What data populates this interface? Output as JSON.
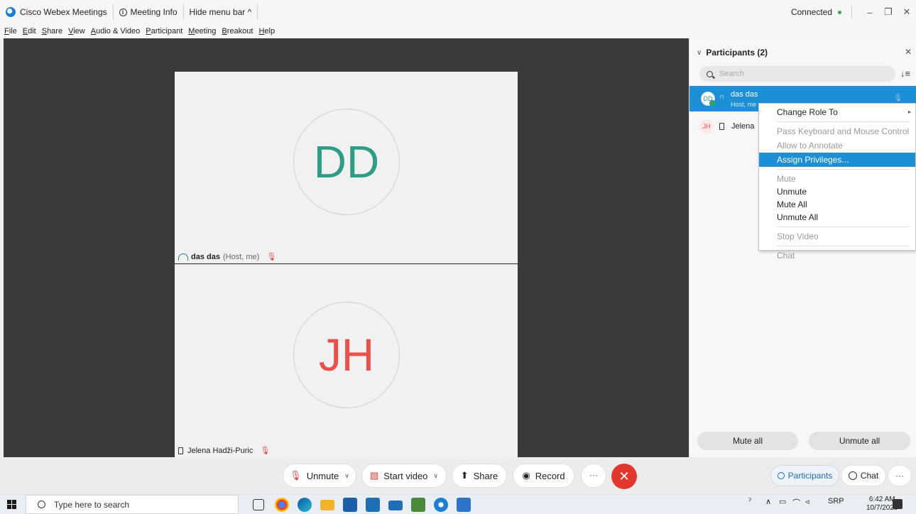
{
  "titlebar": {
    "app_name": "Cisco Webex Meetings",
    "meeting_info": "Meeting Info",
    "hide_menu": "Hide menu bar ^",
    "status": "Connected",
    "minimize": "–",
    "restore": "❐",
    "close": "✕"
  },
  "menubar": [
    "File",
    "Edit",
    "Share",
    "View",
    "Audio & Video",
    "Participant",
    "Meeting",
    "Breakout",
    "Help"
  ],
  "stage": {
    "tile1": {
      "initials": "DD",
      "name": "das das",
      "sub": "(Host, me)"
    },
    "tile2": {
      "initials": "JH",
      "name": "Jelena Hadži-Puric"
    }
  },
  "panel": {
    "title": "Participants (2)",
    "search_placeholder": "Search",
    "participants": [
      {
        "initials": "DD",
        "name": "das das",
        "role": "Host, me"
      },
      {
        "initials": "JH",
        "name": "Jelena"
      }
    ],
    "mute_all": "Mute all",
    "unmute_all": "Unmute all"
  },
  "context_menu": {
    "change_role": "Change Role To",
    "pass_control": "Pass Keyboard and Mouse Control",
    "allow_annotate": "Allow to Annotate",
    "assign_privileges": "Assign Privileges...",
    "mute": "Mute",
    "unmute": "Unmute",
    "mute_all": "Mute All",
    "unmute_all": "Unmute All",
    "stop_video": "Stop Video",
    "chat": "Chat"
  },
  "controls": {
    "unmute": "Unmute",
    "start_video": "Start video",
    "share": "Share",
    "record": "Record",
    "more": "···",
    "end": "✕",
    "participants": "Participants",
    "chat": "Chat",
    "right_more": "···"
  },
  "taskbar": {
    "search_placeholder": "Type here to search",
    "language": "SRP",
    "time": "6:42 AM",
    "date": "10/7/2020"
  },
  "colors": {
    "accent_blue": "#1c8fd6",
    "end_red": "#e2372f",
    "dd_green": "#2e9c86",
    "jh_red": "#e8514b"
  }
}
